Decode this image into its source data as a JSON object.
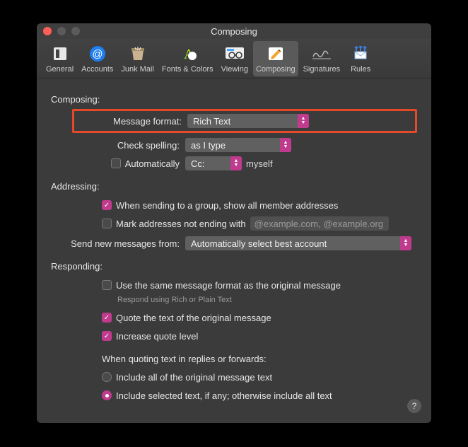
{
  "window_title": "Composing",
  "toolbar": [
    {
      "label": "General"
    },
    {
      "label": "Accounts"
    },
    {
      "label": "Junk Mail"
    },
    {
      "label": "Fonts & Colors"
    },
    {
      "label": "Viewing"
    },
    {
      "label": "Composing"
    },
    {
      "label": "Signatures"
    },
    {
      "label": "Rules"
    }
  ],
  "sections": {
    "composing": {
      "heading": "Composing:",
      "message_format_label": "Message format:",
      "message_format_value": "Rich Text",
      "check_spelling_label": "Check spelling:",
      "check_spelling_value": "as I type",
      "automatically_label": "Automatically",
      "cc_value": "Cc:",
      "myself_label": "myself"
    },
    "addressing": {
      "heading": "Addressing:",
      "group_label": "When sending to a group, show all member addresses",
      "mark_label": "Mark addresses not ending with",
      "mark_placeholder": "@example.com, @example.org",
      "send_from_label": "Send new messages from:",
      "send_from_value": "Automatically select best account"
    },
    "responding": {
      "heading": "Responding:",
      "same_format_label": "Use the same message format as the original message",
      "same_format_note": "Respond using Rich or Plain Text",
      "quote_text_label": "Quote the text of the original message",
      "increase_quote_label": "Increase quote level",
      "quoting_heading": "When quoting text in replies or forwards:",
      "include_all_label": "Include all of the original message text",
      "include_selected_label": "Include selected text, if any; otherwise include all text"
    }
  },
  "help_tooltip": "?"
}
